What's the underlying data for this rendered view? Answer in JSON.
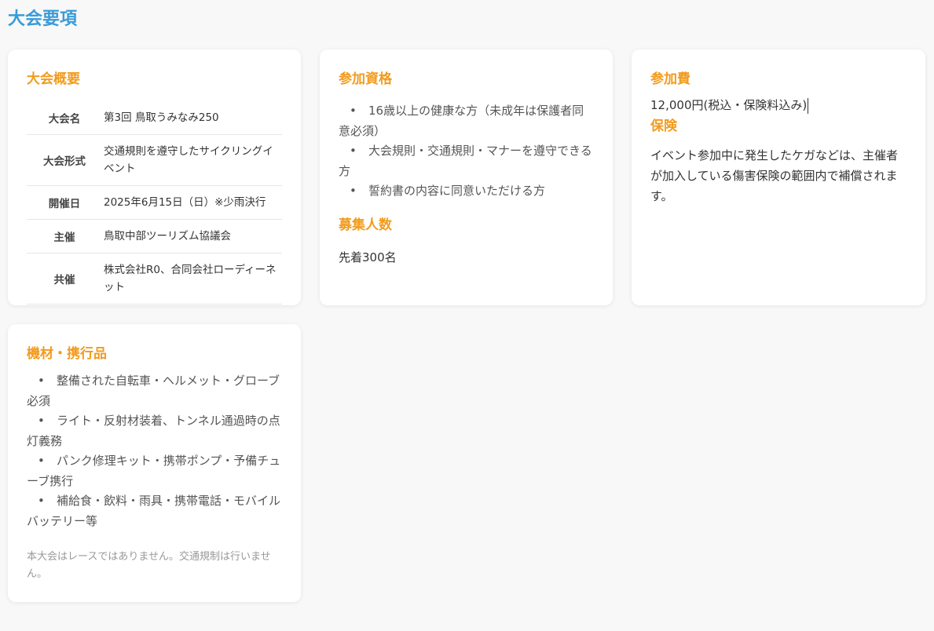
{
  "page_title": "大会要項",
  "overview": {
    "heading": "大会概要",
    "rows": [
      {
        "label": "大会名",
        "value": "第3回 鳥取うみなみ250"
      },
      {
        "label": "大会形式",
        "value": "交通規則を遵守したサイクリングイベント"
      },
      {
        "label": "開催日",
        "value": "2025年6月15日（日）※少雨決行"
      },
      {
        "label": "主催",
        "value": "鳥取中部ツーリズム協議会"
      },
      {
        "label": "共催",
        "value": "株式会社R0、合同会社ローディーネット"
      }
    ]
  },
  "eligibility": {
    "heading": "参加資格",
    "items": [
      "16歳以上の健康な方（未成年は保護者同意必須）",
      "大会規則・交通規則・マナーを遵守できる方",
      "誓約書の内容に同意いただける方"
    ],
    "capacity_heading": "募集人数",
    "capacity_value": "先着300名"
  },
  "fee": {
    "heading": "参加費",
    "value": "12,000円(税込・保険料込み)",
    "insurance_heading": "保険",
    "insurance_text": "イベント参加中に発生したケガなどは、主催者が加入している傷害保険の範囲内で補償されます。"
  },
  "equipment": {
    "heading": "機材・携行品",
    "items": [
      "整備された自転車・ヘルメット・グローブ必須",
      "ライト・反射材装着、トンネル通過時の点灯義務",
      "パンク修理キット・携帯ポンプ・予備チューブ携行",
      "補給食・飲料・雨具・携帯電話・モバイルバッテリー等"
    ],
    "note": "本大会はレースではありません。交通規制は行いません。"
  }
}
